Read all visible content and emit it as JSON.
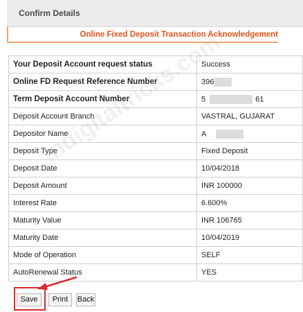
{
  "header": {
    "title": "Confirm Details"
  },
  "acknowledgement": {
    "text": "Online Fixed Deposit Transaction Acknowledgement"
  },
  "watermark": {
    "text": "indigitaltricks.com"
  },
  "details": {
    "rows": [
      {
        "label": "Your Deposit Account request status",
        "value": "Success"
      },
      {
        "label": "Online FD Request Reference Number",
        "value": "396"
      },
      {
        "label": "Term Deposit Account Number",
        "value": "5",
        "value_suffix": "61"
      },
      {
        "label": "Deposit Account Branch",
        "value": "VASTRAL, GUJARAT"
      },
      {
        "label": "Depositor Name",
        "value": "A"
      },
      {
        "label": "Deposit Type",
        "value": "Fixed Deposit"
      },
      {
        "label": "Deposit Date",
        "value": "10/04/2018"
      },
      {
        "label": "Deposit Amount",
        "value": "INR 100000"
      },
      {
        "label": "Interest Rate",
        "value": "6.600%"
      },
      {
        "label": "Maturity Value",
        "value": "INR 106765"
      },
      {
        "label": "Maturity Date",
        "value": "10/04/2019"
      },
      {
        "label": "Mode of Operation",
        "value": "SELF"
      },
      {
        "label": "AutoRenewal Status",
        "value": "YES"
      }
    ]
  },
  "buttons": {
    "save": "Save",
    "print": "Print",
    "back": "Back"
  },
  "colors": {
    "accent": "#e3541b",
    "highlight": "#e0292f"
  }
}
